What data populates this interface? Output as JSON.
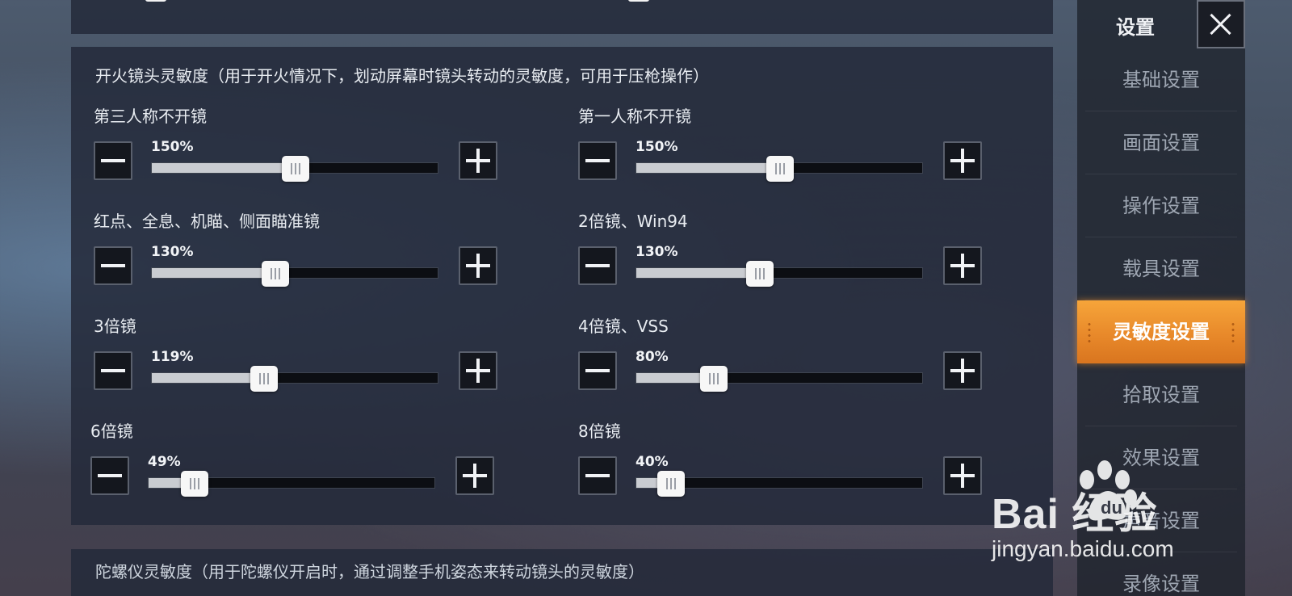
{
  "fire_sensitivity": {
    "title": "开火镜头灵敏度（用于开火情况下，划动屏幕时镜头转动的灵敏度，可用于压枪操作）",
    "sliders": [
      {
        "label": "第三人称不开镜",
        "value_text": "150%",
        "fraction": 0.5
      },
      {
        "label": "第一人称不开镜",
        "value_text": "150%",
        "fraction": 0.5
      },
      {
        "label": "红点、全息、机瞄、侧面瞄准镜",
        "value_text": "130%",
        "fraction": 0.43
      },
      {
        "label": "2倍镜、Win94",
        "value_text": "130%",
        "fraction": 0.43
      },
      {
        "label": "3倍镜",
        "value_text": "119%",
        "fraction": 0.39
      },
      {
        "label": "4倍镜、VSS",
        "value_text": "80%",
        "fraction": 0.27
      },
      {
        "label": "6倍镜",
        "value_text": "49%",
        "fraction": 0.16
      },
      {
        "label": "8倍镜",
        "value_text": "40%",
        "fraction": 0.12
      }
    ]
  },
  "gyro_sensitivity": {
    "title": "陀螺仪灵敏度（用于陀螺仪开启时，通过调整手机姿态来转动镜头的灵敏度）"
  },
  "sidebar": {
    "title": "设置",
    "items": [
      {
        "label": "基础设置"
      },
      {
        "label": "画面设置"
      },
      {
        "label": "操作设置"
      },
      {
        "label": "载具设置"
      },
      {
        "label": "灵敏度设置"
      },
      {
        "label": "拾取设置"
      },
      {
        "label": "效果设置"
      },
      {
        "label": "声音设置"
      },
      {
        "label": "录像设置"
      }
    ],
    "active_index": 4
  },
  "icons": {
    "close": "close-icon",
    "decrease": "minus-icon",
    "increase": "plus-icon"
  },
  "watermark": {
    "brand": "Bai  经验",
    "url": "jingyan.baidu.com"
  },
  "colors": {
    "accent": "#e8892a",
    "panel": "#242a3a"
  }
}
